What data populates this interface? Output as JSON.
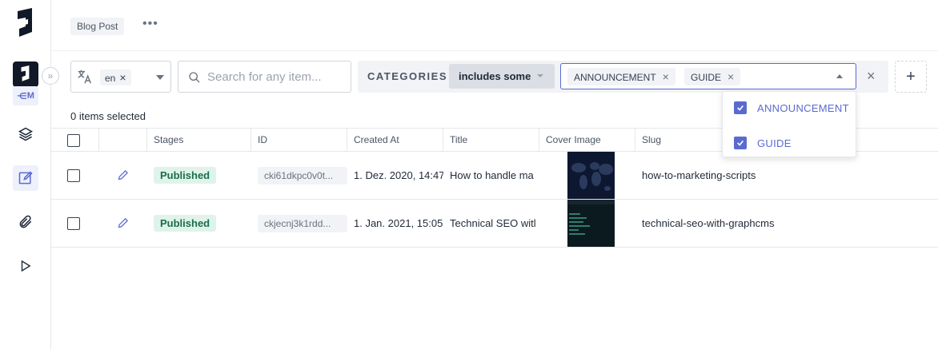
{
  "sidebar": {
    "env_label": "M",
    "items": [
      {
        "name": "schema",
        "icon": "layers-icon"
      },
      {
        "name": "content",
        "icon": "edit-icon",
        "active": true
      },
      {
        "name": "assets",
        "icon": "paperclip-icon"
      },
      {
        "name": "playground",
        "icon": "play-icon"
      }
    ]
  },
  "header": {
    "model": "Blog Post",
    "more": "•••"
  },
  "filters": {
    "locale_value": "en",
    "search_placeholder": "Search for any item...",
    "category_label": "CATEGORIES",
    "operator": "includes some",
    "selected_values": [
      "ANNOUNCEMENT",
      "GUIDE"
    ],
    "add_label": "+"
  },
  "dropdown": {
    "options": [
      {
        "label": "ANNOUNCEMENT",
        "checked": true
      },
      {
        "label": "GUIDE",
        "checked": true
      }
    ]
  },
  "selection_info": "0 items selected",
  "table": {
    "columns": [
      "Stages",
      "ID",
      "Created At",
      "Title",
      "Cover Image",
      "Slug"
    ],
    "rows": [
      {
        "stage": "Published",
        "id": "cki61dkpc0v0t...",
        "created": "1. Dez. 2020, 14:47",
        "title": "How to handle ma",
        "slug": "how-to-marketing-scripts"
      },
      {
        "stage": "Published",
        "id": "ckjecnj3k1rdd...",
        "created": "1. Jan. 2021, 15:05",
        "title": "Technical SEO witl",
        "slug": "technical-seo-with-graphcms"
      }
    ]
  },
  "colors": {
    "accent": "#5b6ad0",
    "published_bg": "#dff3ea",
    "published_text": "#1a6e4a"
  }
}
